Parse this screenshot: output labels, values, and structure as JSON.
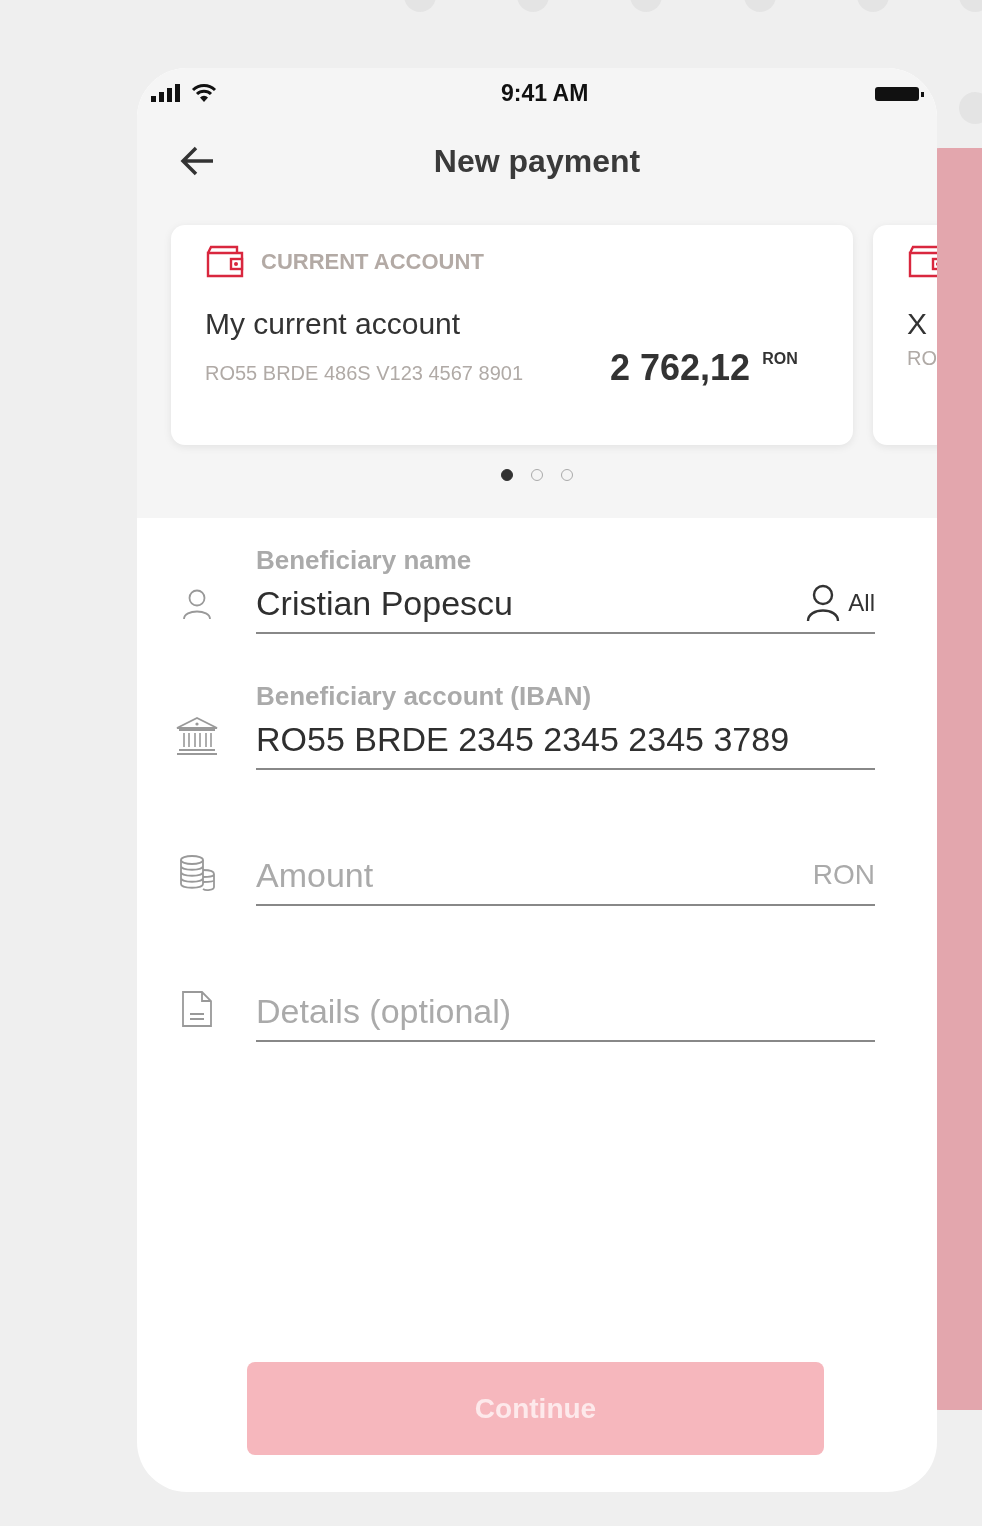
{
  "status_bar": {
    "time": "9:41 AM"
  },
  "header": {
    "title": "New payment"
  },
  "accounts": [
    {
      "type": "CURRENT ACCOUNT",
      "name": "My current account",
      "iban": "RO55 BRDE 486S V123 4567 8901",
      "balance": "2 762,12",
      "currency": "RON"
    },
    {
      "name": "X",
      "iban": "RO"
    }
  ],
  "pager": [
    {
      "selected": true
    },
    {
      "selected": false
    },
    {
      "selected": false
    }
  ],
  "fields": [
    {
      "kind": "filled",
      "label": "Beneficiary name",
      "value": "Cristian Popescu",
      "action": "All"
    },
    {
      "kind": "filled",
      "label": "Beneficiary account (IBAN)",
      "value": "RO55 BRDE 2345 2345 2345 3789"
    },
    {
      "kind": "empty",
      "placeholder": "Amount",
      "suffix": "RON"
    },
    {
      "kind": "empty",
      "placeholder": "Details (optional)"
    }
  ],
  "continue_button": {
    "label": "Continue",
    "disabled": true
  }
}
